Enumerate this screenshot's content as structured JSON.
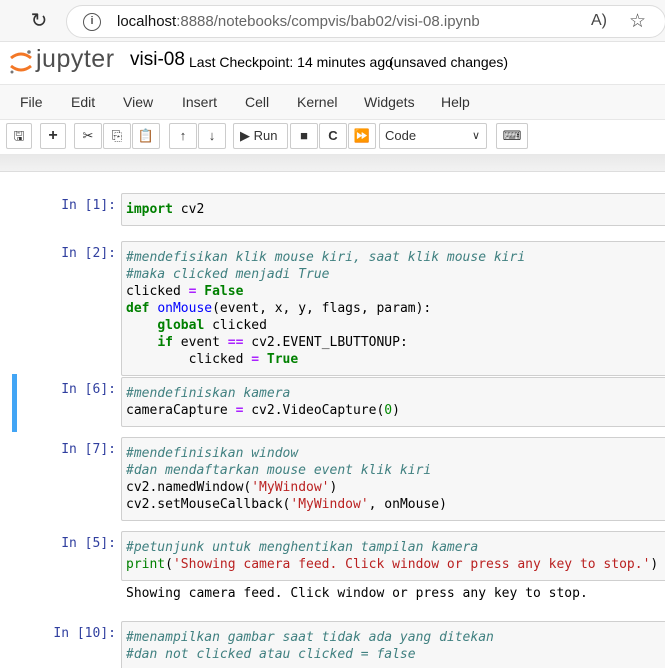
{
  "browser": {
    "url_host": "localhost",
    "url_rest": ":8888/notebooks/compvis/bab02/visi-08.ipynb"
  },
  "header": {
    "logo_text": "jupyter",
    "notebook_title": "visi-08",
    "checkpoint": "Last Checkpoint: 14 minutes ago",
    "status": "(unsaved changes)"
  },
  "menu": [
    "File",
    "Edit",
    "View",
    "Insert",
    "Cell",
    "Kernel",
    "Widgets",
    "Help"
  ],
  "toolbar": {
    "run_label": "Run",
    "cell_type": "Code"
  },
  "cells": [
    {
      "prompt": "In [1]:"
    },
    {
      "prompt": "In [2]:"
    },
    {
      "prompt": "In [6]:"
    },
    {
      "prompt": "In [7]:"
    },
    {
      "prompt": "In [5]:",
      "output": "Showing camera feed. Click window or press any key to stop."
    },
    {
      "prompt": "In [10]:"
    }
  ],
  "code": {
    "c1": [
      "import",
      " cv2"
    ],
    "c2_l1": "#mendefisikan klik mouse kiri, saat klik mouse kiri",
    "c2_l2": "#maka clicked menjadi True",
    "c3_l1": "#mendefiniskan kamera",
    "c4_l1": "#mendefinisikan window",
    "c4_l2": "#dan mendaftarkan mouse event klik kiri",
    "c5_l1": "#petunjunk untuk menghentikan tampilan kamera",
    "c5_str": "'Showing camera feed. Click window or press any key to stop.'",
    "c6_l1": "#menampilkan gambar saat tidak ada yang ditekan",
    "c6_l2": "#dan not clicked atau clicked = false"
  }
}
